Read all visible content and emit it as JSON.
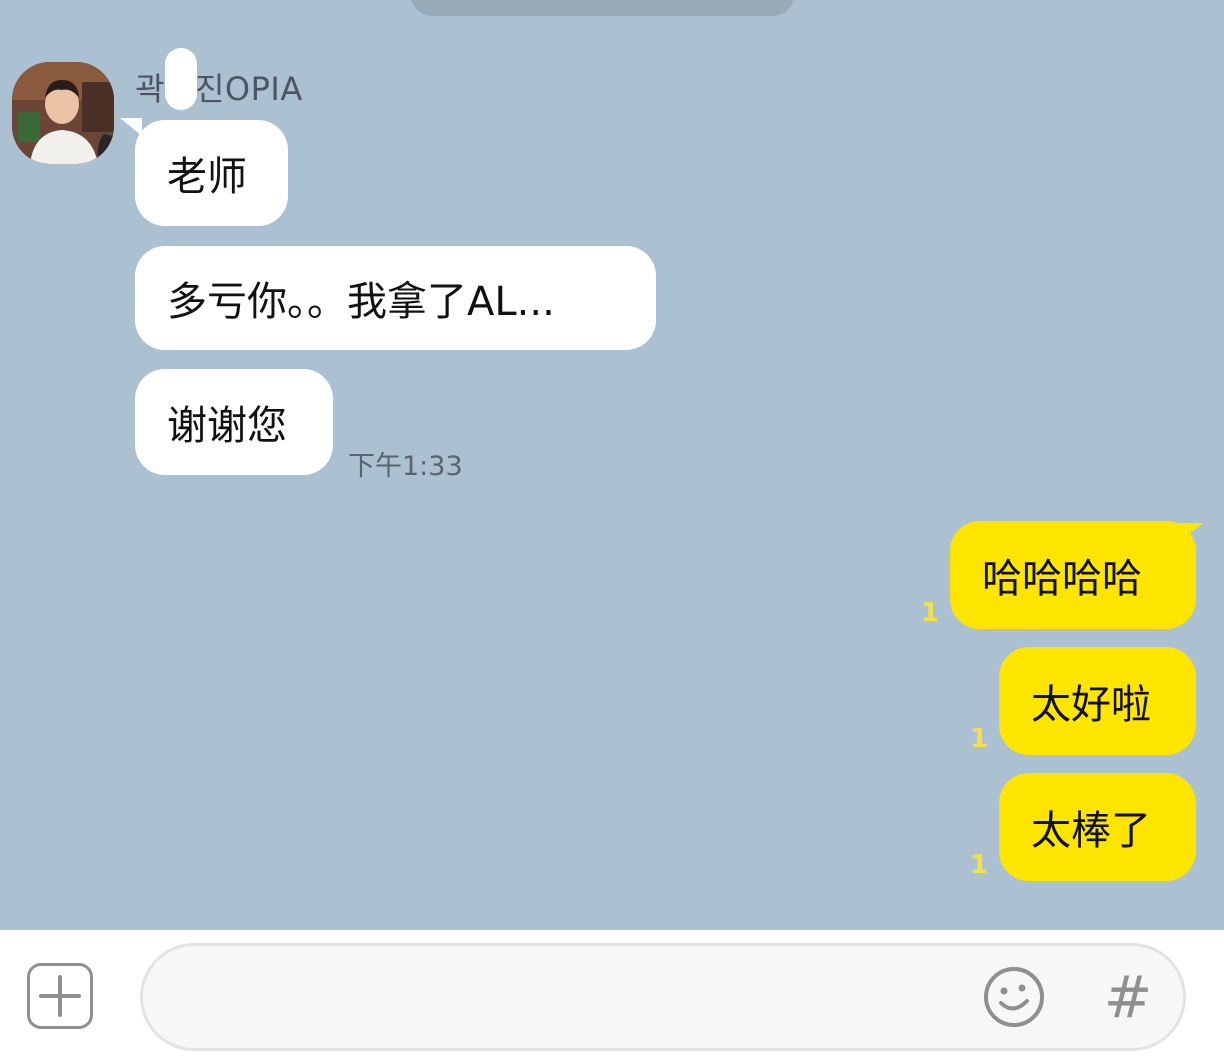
{
  "chat": {
    "sender_name_prefix": "곽",
    "sender_name_suffix": "진OPIA",
    "incoming": [
      {
        "text": "老师"
      },
      {
        "text": "多亏你。。我拿了AL..."
      },
      {
        "text": "谢谢您"
      }
    ],
    "incoming_time": "下午1:33",
    "outgoing": [
      {
        "text": "哈哈哈哈",
        "unread": "1"
      },
      {
        "text": "太好啦",
        "unread": "1"
      },
      {
        "text": "太棒了",
        "unread": "1"
      }
    ]
  },
  "composer": {
    "text_value": "",
    "hash_label": "#"
  },
  "icons": {
    "attach": "plus-square-icon",
    "emoji": "smiley-icon",
    "hashtag": "hash-icon"
  },
  "colors": {
    "background": "#abc1d1",
    "incoming_bubble": "#ffffff",
    "outgoing_bubble": "#fee500",
    "unread_count": "#f5e04a"
  }
}
